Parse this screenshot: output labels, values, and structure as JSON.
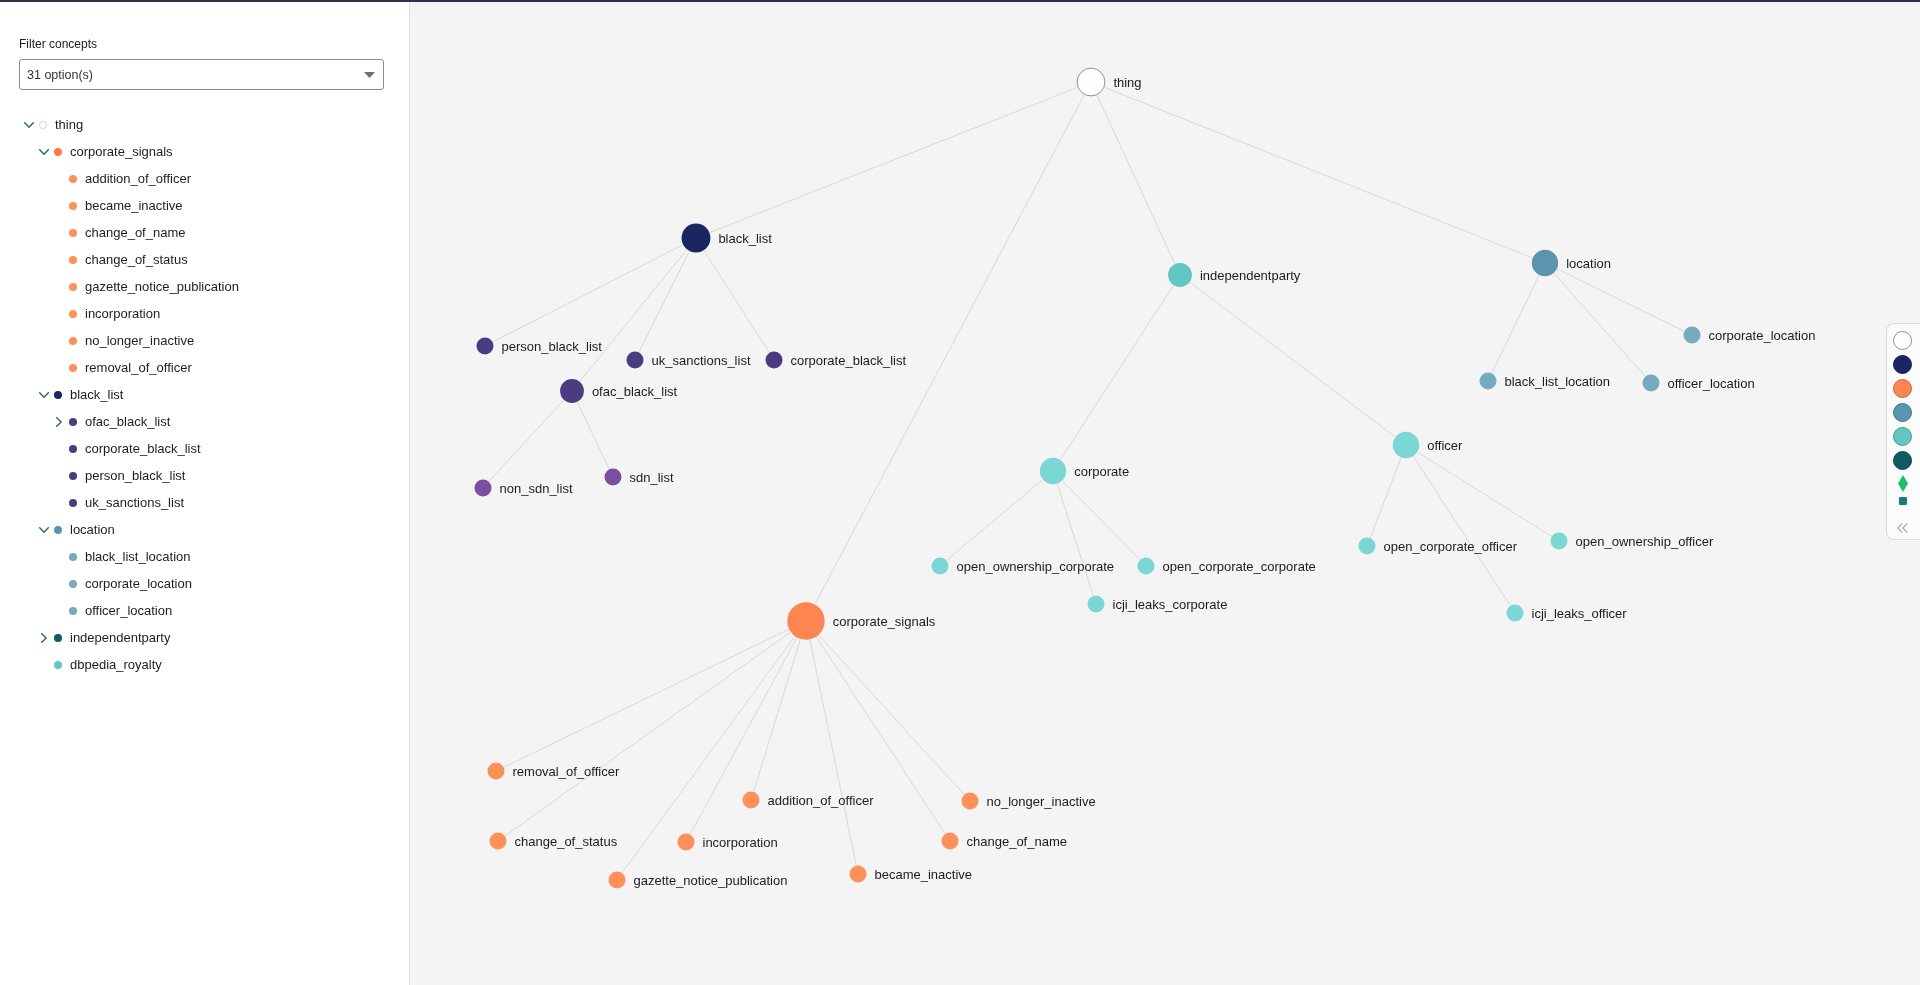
{
  "sidebar": {
    "filter": {
      "label": "Filter concepts",
      "value": "31 option(s)"
    },
    "tree": [
      {
        "label": "thing",
        "color": "#ffffff",
        "kind": "group",
        "expanded": true,
        "children": [
          {
            "label": "corporate_signals",
            "color": "#fd7a4a",
            "kind": "group",
            "expanded": true,
            "children": [
              {
                "label": "addition_of_officer",
                "color": "#fd9159",
                "kind": "leaf"
              },
              {
                "label": "became_inactive",
                "color": "#fd9159",
                "kind": "leaf"
              },
              {
                "label": "change_of_name",
                "color": "#fd9159",
                "kind": "leaf"
              },
              {
                "label": "change_of_status",
                "color": "#fd9159",
                "kind": "leaf"
              },
              {
                "label": "gazette_notice_publication",
                "color": "#fd9159",
                "kind": "leaf"
              },
              {
                "label": "incorporation",
                "color": "#fd9159",
                "kind": "leaf"
              },
              {
                "label": "no_longer_inactive",
                "color": "#fd9159",
                "kind": "leaf"
              },
              {
                "label": "removal_of_officer",
                "color": "#fd9159",
                "kind": "leaf"
              }
            ]
          },
          {
            "label": "black_list",
            "color": "#1b2561",
            "kind": "group",
            "expanded": true,
            "children": [
              {
                "label": "ofac_black_list",
                "color": "#4b3b80",
                "kind": "group",
                "expanded": false
              },
              {
                "label": "corporate_black_list",
                "color": "#4b3b80",
                "kind": "leaf"
              },
              {
                "label": "person_black_list",
                "color": "#4b3b80",
                "kind": "leaf"
              },
              {
                "label": "uk_sanctions_list",
                "color": "#4b3b80",
                "kind": "leaf"
              }
            ]
          },
          {
            "label": "location",
            "color": "#5a95ad",
            "kind": "group",
            "expanded": true,
            "children": [
              {
                "label": "black_list_location",
                "color": "#74abbe",
                "kind": "leaf"
              },
              {
                "label": "corporate_location",
                "color": "#74abbe",
                "kind": "leaf"
              },
              {
                "label": "officer_location",
                "color": "#74abbe",
                "kind": "leaf"
              }
            ]
          },
          {
            "label": "independentparty",
            "color": "#0d5b63",
            "kind": "group",
            "expanded": false
          },
          {
            "label": "dbpedia_royalty",
            "color": "#62c6c3",
            "kind": "leaf"
          }
        ]
      }
    ]
  },
  "graph": {
    "nodes": [
      {
        "label": "thing",
        "color": "#ffffff",
        "children": [
          {
            "label": "black_list",
            "color": "#1b2561",
            "children": [
              {
                "label": "person_black_list",
                "color": "#4b3b80"
              },
              {
                "label": "uk_sanctions_list",
                "color": "#4b3b80"
              },
              {
                "label": "corporate_black_list",
                "color": "#4b3b80"
              },
              {
                "label": "ofac_black_list",
                "color": "#4b3b80",
                "children": [
                  {
                    "label": "non_sdn_list",
                    "color": "#7b4f9f"
                  },
                  {
                    "label": "sdn_list",
                    "color": "#7b4f9f"
                  }
                ]
              }
            ]
          },
          {
            "label": "independentparty",
            "color": "#62c6c3",
            "children": [
              {
                "label": "corporate",
                "color": "#7bd7d4",
                "children": [
                  {
                    "label": "open_ownership_corporate",
                    "color": "#7bd7d4"
                  },
                  {
                    "label": "open_corporate_corporate",
                    "color": "#7bd7d4"
                  },
                  {
                    "label": "icji_leaks_corporate",
                    "color": "#7bd7d4"
                  }
                ]
              },
              {
                "label": "officer",
                "color": "#7bd7d4",
                "children": [
                  {
                    "label": "open_corporate_officer",
                    "color": "#7bd7d4"
                  },
                  {
                    "label": "open_ownership_officer",
                    "color": "#7bd7d4"
                  },
                  {
                    "label": "icji_leaks_officer",
                    "color": "#7bd7d4"
                  }
                ]
              }
            ]
          },
          {
            "label": "location",
            "color": "#5a95ad",
            "children": [
              {
                "label": "corporate_location",
                "color": "#74abbe"
              },
              {
                "label": "black_list_location",
                "color": "#74abbe"
              },
              {
                "label": "officer_location",
                "color": "#74abbe"
              }
            ]
          },
          {
            "label": "corporate_signals",
            "color": "#fd8550",
            "children": [
              {
                "label": "removal_of_officer",
                "color": "#fd9159"
              },
              {
                "label": "addition_of_officer",
                "color": "#fd9159"
              },
              {
                "label": "no_longer_inactive",
                "color": "#fd9159"
              },
              {
                "label": "change_of_status",
                "color": "#fd9159"
              },
              {
                "label": "incorporation",
                "color": "#fd9159"
              },
              {
                "label": "change_of_name",
                "color": "#fd9159"
              },
              {
                "label": "gazette_notice_publication",
                "color": "#fd9159"
              },
              {
                "label": "became_inactive",
                "color": "#fd9159"
              }
            ]
          }
        ]
      }
    ]
  },
  "legend": [
    {
      "kind": "circle",
      "color": "#ffffff"
    },
    {
      "kind": "circle",
      "color": "#1b2561"
    },
    {
      "kind": "circle",
      "color": "#fd8550"
    },
    {
      "kind": "circle",
      "color": "#5a95ad"
    },
    {
      "kind": "circle",
      "color": "#62c6c3"
    },
    {
      "kind": "circle",
      "color": "#0d5b63"
    },
    {
      "kind": "diamond",
      "color": "#1dbf6b"
    },
    {
      "kind": "square",
      "color": "#13807a"
    }
  ]
}
